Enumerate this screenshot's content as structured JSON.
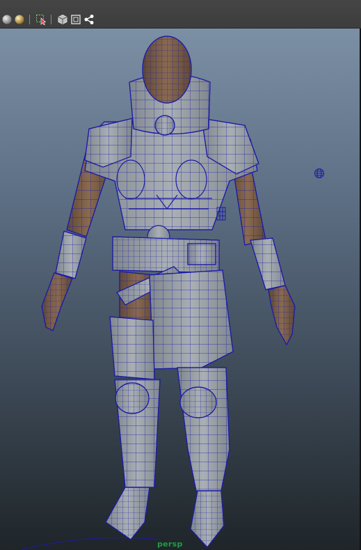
{
  "toolbar": {
    "buttons": [
      {
        "name": "smooth-shade-sphere-icon",
        "color": "#bdbdbd"
      },
      {
        "name": "lighting-sphere-icon",
        "color": "#d9a437"
      },
      {
        "name": "select-tool-icon",
        "color": "#7ecf6b"
      },
      {
        "name": "cube-icon",
        "color": "#dcdcdc"
      },
      {
        "name": "frame-icon",
        "color": "#dcdcdc"
      },
      {
        "name": "node-graph-icon",
        "color": "#ffffff"
      }
    ]
  },
  "viewport": {
    "camera_label": "persp",
    "colors": {
      "wire": "#1c1ca6",
      "armor": "#9ba1a7",
      "skin": "#7d5f47",
      "label": "#1e9e43"
    }
  }
}
